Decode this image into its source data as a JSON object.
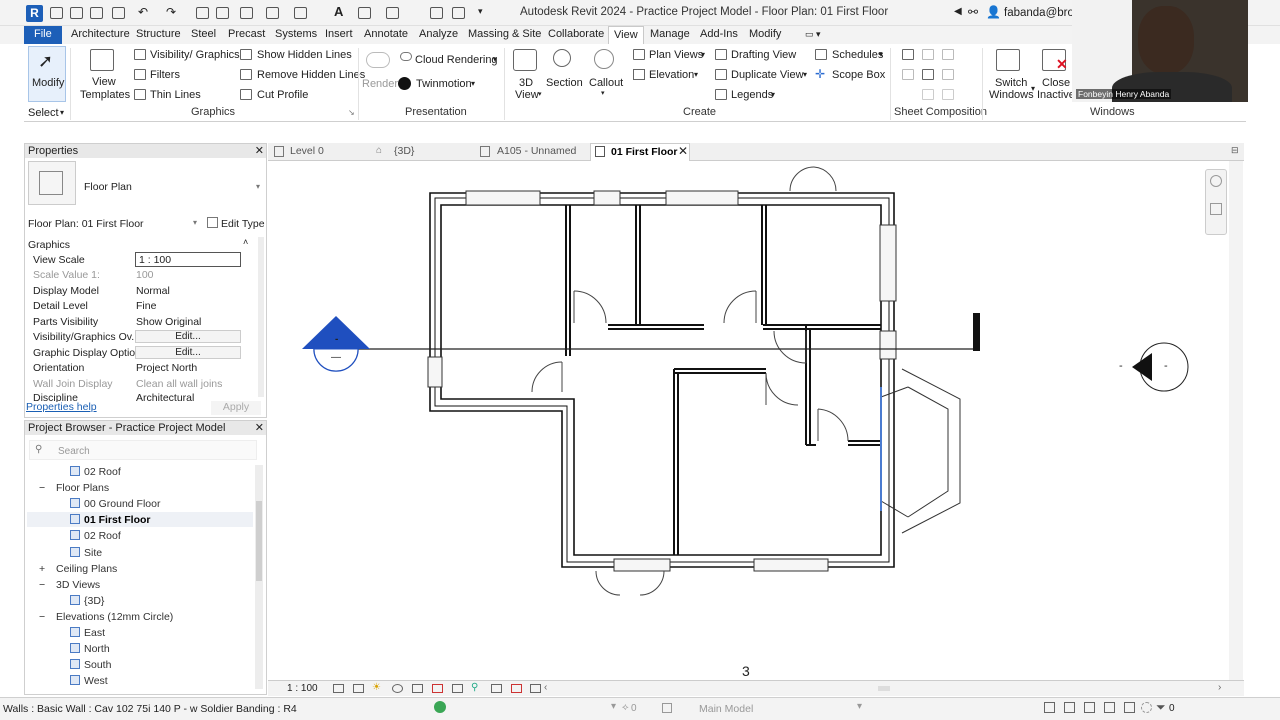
{
  "titlebar": {
    "title": "Autodesk Revit 2024 - Practice Project Model - Floor Plan: 01 First Floor",
    "user": "fabanda@bro...",
    "logo": "R"
  },
  "tabs": [
    "File",
    "Architecture",
    "Structure",
    "Steel",
    "Precast",
    "Systems",
    "Insert",
    "Annotate",
    "Analyze",
    "Massing & Site",
    "Collaborate",
    "View",
    "Manage",
    "Add-Ins",
    "Modify"
  ],
  "active_tab": "View",
  "ribbon": {
    "modify": "Modify",
    "select": "Select",
    "view_templates_1": "View",
    "view_templates_2": "Templates",
    "visibility_graphics": "Visibility/ Graphics",
    "filters": "Filters",
    "thin_lines": "Thin Lines",
    "show_hidden_lines": "Show Hidden Lines",
    "remove_hidden_lines": "Remove Hidden Lines",
    "cut_profile": "Cut Profile",
    "render": "Render",
    "cloud_rendering": "Cloud Rendering",
    "twinmotion": "Twinmotion",
    "view_3d_1": "3D",
    "view_3d_2": "View",
    "section": "Section",
    "callout": "Callout",
    "plan_views": "Plan Views",
    "elevation": "Elevation",
    "drafting_view": "Drafting View",
    "duplicate_view": "Duplicate View",
    "legends": "Legends",
    "schedules": "Schedules",
    "scope_box": "Scope Box",
    "switch_windows_1": "Switch",
    "switch_windows_2": "Windows",
    "close_inactive_1": "Close",
    "close_inactive_2": "Inactive",
    "panels": {
      "graphics": "Graphics",
      "presentation": "Presentation",
      "create": "Create",
      "sheet_composition": "Sheet Composition",
      "windows": "Windows"
    }
  },
  "properties": {
    "title": "Properties",
    "type_name": "Floor Plan",
    "selector": "Floor Plan: 01 First Floor",
    "edit_type": "Edit Type",
    "group": "Graphics",
    "rows": [
      {
        "label": "View Scale",
        "value": "1 : 100"
      },
      {
        "label": "Scale Value    1:",
        "value": "100"
      },
      {
        "label": "Display Model",
        "value": "Normal"
      },
      {
        "label": "Detail Level",
        "value": "Fine"
      },
      {
        "label": "Parts Visibility",
        "value": "Show Original"
      },
      {
        "label": "Visibility/Graphics Ov...",
        "value": "Edit..."
      },
      {
        "label": "Graphic Display Optio...",
        "value": "Edit..."
      },
      {
        "label": "Orientation",
        "value": "Project North"
      },
      {
        "label": "Wall Join Display",
        "value": "Clean all wall joins"
      },
      {
        "label": "Discipline",
        "value": "Architectural"
      }
    ],
    "help": "Properties help",
    "apply": "Apply"
  },
  "browser": {
    "title": "Project Browser - Practice Project Model",
    "search_placeholder": "Search",
    "items": [
      {
        "label": "02 Roof",
        "level": 2,
        "icon": true,
        "bold": false
      },
      {
        "label": "Floor Plans",
        "level": 1,
        "icon": false,
        "bold": false,
        "toggle": "−"
      },
      {
        "label": "00 Ground Floor",
        "level": 2,
        "icon": true,
        "bold": false
      },
      {
        "label": "01 First Floor",
        "level": 2,
        "icon": true,
        "bold": true
      },
      {
        "label": "02 Roof",
        "level": 2,
        "icon": true,
        "bold": false
      },
      {
        "label": "Site",
        "level": 2,
        "icon": true,
        "bold": false
      },
      {
        "label": "Ceiling Plans",
        "level": 1,
        "icon": false,
        "bold": false,
        "toggle": "+"
      },
      {
        "label": "3D Views",
        "level": 1,
        "icon": false,
        "bold": false,
        "toggle": "−"
      },
      {
        "label": "{3D}",
        "level": 2,
        "icon": true,
        "bold": false
      },
      {
        "label": "Elevations (12mm Circle)",
        "level": 1,
        "icon": false,
        "bold": false,
        "toggle": "−"
      },
      {
        "label": "East",
        "level": 2,
        "icon": true,
        "bold": false
      },
      {
        "label": "North",
        "level": 2,
        "icon": true,
        "bold": false
      },
      {
        "label": "South",
        "level": 2,
        "icon": true,
        "bold": false
      },
      {
        "label": "West",
        "level": 2,
        "icon": true,
        "bold": false
      }
    ]
  },
  "view_tabs": [
    "Level 0",
    "{3D}",
    "A105 - Unnamed",
    "01 First Floor"
  ],
  "active_view": "01 First Floor",
  "canvas": {
    "page_number": "3",
    "section_marker": "-",
    "section_marker_2": "—",
    "elevation_marker": "-",
    "elevation_dash": "-"
  },
  "view_control": {
    "scale": "1 : 100"
  },
  "status": {
    "message": "Walls : Basic Wall : Cav 102 75i 140 P - w Soldier Banding : R4",
    "count_1": "0",
    "model": "Main Model",
    "filter_count": "0"
  },
  "webcam": {
    "label": "Fonbeyin Henry Abanda"
  },
  "colors": {
    "accent": "#1d5fb8",
    "section_blue": "#1f4fbf"
  }
}
